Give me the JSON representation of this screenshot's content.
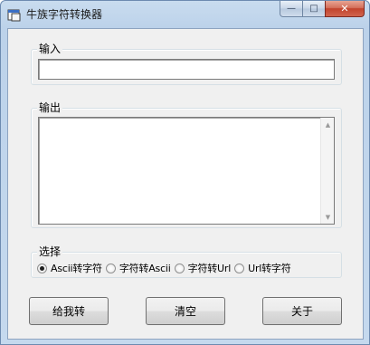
{
  "window": {
    "title": "牛族字符转换器"
  },
  "caption": {
    "minimize_glyph": "—",
    "maximize_glyph": "□",
    "close_glyph": "✕"
  },
  "input_group": {
    "legend": "输入",
    "value": ""
  },
  "output_group": {
    "legend": "输出",
    "value": "",
    "scroll_up_glyph": "▲",
    "scroll_down_glyph": "▼"
  },
  "select_group": {
    "legend": "选择",
    "options": [
      {
        "label": "Ascii转字符",
        "selected": true
      },
      {
        "label": "字符转Ascii",
        "selected": false
      },
      {
        "label": "字符转Url",
        "selected": false
      },
      {
        "label": "Url转字符",
        "selected": false
      }
    ]
  },
  "buttons": {
    "convert": "给我转",
    "clear": "清空",
    "about": "关于"
  },
  "colors": {
    "title_bar": "#c9dcef",
    "client": "#f0f0f0",
    "close_button": "#c2432d"
  }
}
